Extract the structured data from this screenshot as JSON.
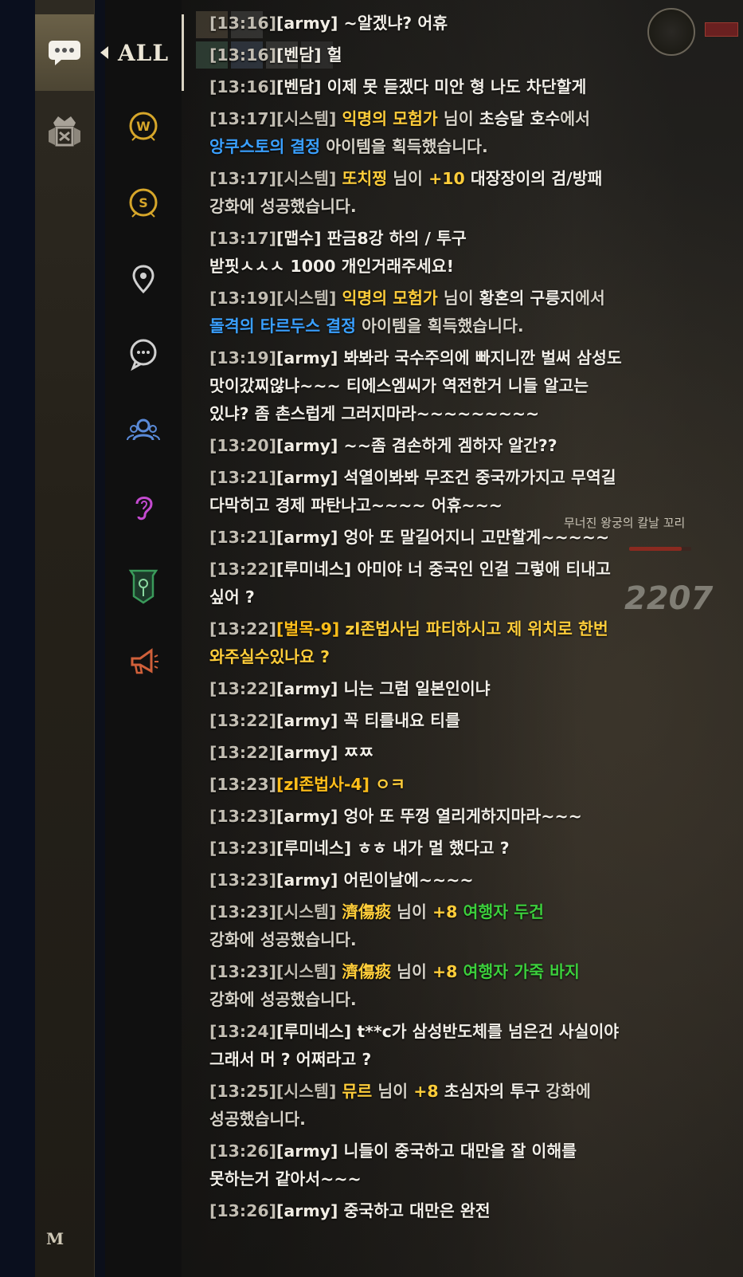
{
  "tabs": {
    "all_label": "ALL"
  },
  "sidebar": {
    "buttons": [
      {
        "icon": "chat-bubble-icon",
        "active": true
      },
      {
        "icon": "guild-crest-icon",
        "active": false
      }
    ],
    "channels": [
      {
        "icon": "world-channel-icon",
        "color": "#d6a62a"
      },
      {
        "icon": "server-channel-icon",
        "color": "#d6a62a"
      },
      {
        "icon": "location-pin-icon",
        "color": "#d0d0d0"
      },
      {
        "icon": "general-chat-icon",
        "color": "#d0d0d0"
      },
      {
        "icon": "party-icon",
        "color": "#5a8ad8"
      },
      {
        "icon": "whisper-ear-icon",
        "color": "#c44ad0"
      },
      {
        "icon": "guild-banner-icon",
        "color": "#3a9a5a"
      },
      {
        "icon": "megaphone-icon",
        "color": "#d0603a"
      }
    ],
    "bottom_label": "M"
  },
  "map": {
    "location_label": "무너진 왕궁의 칼날 꼬리",
    "damage_number": "2207",
    "monster_hp": 0.85
  },
  "colors": {
    "timestamp": "#c2bdb2",
    "yellow_name": "#ffbe1a",
    "item_blue": "#3aa0ff",
    "item_green": "#3ccf3c"
  },
  "messages": [
    {
      "parts": [
        {
          "t": "[13:16]",
          "c": "ts"
        },
        {
          "t": "[army]",
          "c": "snd"
        },
        {
          "t": " ~알겠냐? 어휴"
        }
      ]
    },
    {
      "parts": [
        {
          "t": "[13:16]",
          "c": "ts"
        },
        {
          "t": "[벤담]",
          "c": "snd"
        },
        {
          "t": " 헐"
        }
      ]
    },
    {
      "parts": [
        {
          "t": "[13:16]",
          "c": "ts"
        },
        {
          "t": "[벤담]",
          "c": "snd"
        },
        {
          "t": " 이제 못 듣겠다 미안 형 나도 차단할게"
        }
      ]
    },
    {
      "parts": [
        {
          "t": "[13:17]",
          "c": "ts"
        },
        {
          "t": "[시스템]",
          "c": "snd-sys"
        },
        {
          "t": " "
        },
        {
          "t": "익명의 모험가",
          "c": "hl-yel"
        },
        {
          "t": " 님이 ",
          "c": "dim"
        },
        {
          "t": "초승달 호수"
        },
        {
          "t": "에서",
          "c": "dim"
        },
        {
          "t": "\n"
        },
        {
          "t": "앙쿠스토의 결정",
          "c": "hl-blue"
        },
        {
          "t": " 아이템을 획득했습니다.",
          "c": "dim"
        }
      ]
    },
    {
      "parts": [
        {
          "t": "[13:17]",
          "c": "ts"
        },
        {
          "t": "[시스템]",
          "c": "snd-sys"
        },
        {
          "t": " "
        },
        {
          "t": "또치찡",
          "c": "hl-yel"
        },
        {
          "t": " 님이 ",
          "c": "dim"
        },
        {
          "t": "+10",
          "c": "hl-yel"
        },
        {
          "t": " 대장장이의 검/방패"
        },
        {
          "t": "\n"
        },
        {
          "t": "강화에 성공했습니다.",
          "c": "dim"
        }
      ]
    },
    {
      "parts": [
        {
          "t": "[13:17]",
          "c": "ts"
        },
        {
          "t": "[맵수]",
          "c": "snd"
        },
        {
          "t": " 판금8강 하의 / 투구"
        },
        {
          "t": "\n"
        },
        {
          "t": "받핏ㅅㅅㅅ 1000 개인거래주세요!"
        }
      ]
    },
    {
      "parts": [
        {
          "t": "[13:19]",
          "c": "ts"
        },
        {
          "t": "[시스템]",
          "c": "snd-sys"
        },
        {
          "t": " "
        },
        {
          "t": "익명의 모험가",
          "c": "hl-yel"
        },
        {
          "t": " 님이 ",
          "c": "dim"
        },
        {
          "t": "황혼의 구릉지"
        },
        {
          "t": "에서",
          "c": "dim"
        },
        {
          "t": "\n"
        },
        {
          "t": "돌격의 타르두스 결정",
          "c": "hl-blue"
        },
        {
          "t": " 아이템을 획득했습니다.",
          "c": "dim"
        }
      ]
    },
    {
      "parts": [
        {
          "t": "[13:19]",
          "c": "ts"
        },
        {
          "t": "[army]",
          "c": "snd"
        },
        {
          "t": " 봐봐라 국수주의에 빠지니깐 벌써 삼성도"
        },
        {
          "t": "\n"
        },
        {
          "t": "맛이갔찌않냐~~~ 티에스엠씨가 역전한거 니들 알고는"
        },
        {
          "t": "\n"
        },
        {
          "t": "있냐? 좀 촌스럽게 그러지마라~~~~~~~~~"
        }
      ]
    },
    {
      "parts": [
        {
          "t": "[13:20]",
          "c": "ts"
        },
        {
          "t": "[army]",
          "c": "snd"
        },
        {
          "t": " ~~좀 겸손하게 겜하자 알간??"
        }
      ]
    },
    {
      "parts": [
        {
          "t": "[13:21]",
          "c": "ts"
        },
        {
          "t": "[army]",
          "c": "snd"
        },
        {
          "t": " 석열이봐봐 무조건 중국까가지고 무역길"
        },
        {
          "t": "\n"
        },
        {
          "t": "다막히고 경제 파탄나고~~~~ 어휴~~~"
        }
      ]
    },
    {
      "parts": [
        {
          "t": "[13:21]",
          "c": "ts"
        },
        {
          "t": "[army]",
          "c": "snd"
        },
        {
          "t": " 엉아 또 말길어지니 고만할게~~~~~"
        }
      ]
    },
    {
      "parts": [
        {
          "t": "[13:22]",
          "c": "ts"
        },
        {
          "t": "[루미네스]",
          "c": "snd"
        },
        {
          "t": " 아미야 너 중국인 인걸 그렇애 티내고"
        },
        {
          "t": "\n"
        },
        {
          "t": "싶어 ?"
        }
      ]
    },
    {
      "parts": [
        {
          "t": "[13:22]",
          "c": "ts"
        },
        {
          "t": "[벌목-9]",
          "c": "snd-yel"
        },
        {
          "t": " zl존법사님 파티하시고 제 위치로 한번",
          "c": "hl-yel"
        },
        {
          "t": "\n"
        },
        {
          "t": "와주실수있나요 ?",
          "c": "hl-yel"
        }
      ]
    },
    {
      "parts": [
        {
          "t": "[13:22]",
          "c": "ts"
        },
        {
          "t": "[army]",
          "c": "snd"
        },
        {
          "t": " 니는 그럼 일본인이냐"
        }
      ]
    },
    {
      "parts": [
        {
          "t": "[13:22]",
          "c": "ts"
        },
        {
          "t": "[army]",
          "c": "snd"
        },
        {
          "t": " 꼭 티를내요 티를"
        }
      ]
    },
    {
      "parts": [
        {
          "t": "[13:22]",
          "c": "ts"
        },
        {
          "t": "[army]",
          "c": "snd"
        },
        {
          "t": " ㅉㅉ"
        }
      ]
    },
    {
      "parts": [
        {
          "t": "[13:23]",
          "c": "ts"
        },
        {
          "t": "[zl존법사-4]",
          "c": "snd-yel"
        },
        {
          "t": " ㅇㅋ",
          "c": "hl-yel"
        }
      ]
    },
    {
      "parts": [
        {
          "t": "[13:23]",
          "c": "ts"
        },
        {
          "t": "[army]",
          "c": "snd"
        },
        {
          "t": " 엉아 또 뚜껑 열리게하지마라~~~"
        }
      ]
    },
    {
      "parts": [
        {
          "t": "[13:23]",
          "c": "ts"
        },
        {
          "t": "[루미네스]",
          "c": "snd"
        },
        {
          "t": " ㅎㅎ 내가 멀 했다고 ?"
        }
      ]
    },
    {
      "parts": [
        {
          "t": "[13:23]",
          "c": "ts"
        },
        {
          "t": "[army]",
          "c": "snd"
        },
        {
          "t": " 어린이날에~~~~"
        }
      ]
    },
    {
      "parts": [
        {
          "t": "[13:23]",
          "c": "ts"
        },
        {
          "t": "[시스템]",
          "c": "snd-sys"
        },
        {
          "t": " "
        },
        {
          "t": "濟傷痰",
          "c": "hl-yel"
        },
        {
          "t": " 님이 ",
          "c": "dim"
        },
        {
          "t": "+8",
          "c": "hl-yel"
        },
        {
          "t": " 여행자 두건",
          "c": "hl-green"
        },
        {
          "t": "\n"
        },
        {
          "t": "강화에 성공했습니다.",
          "c": "dim"
        }
      ]
    },
    {
      "parts": [
        {
          "t": "[13:23]",
          "c": "ts"
        },
        {
          "t": "[시스템]",
          "c": "snd-sys"
        },
        {
          "t": " "
        },
        {
          "t": "濟傷痰",
          "c": "hl-yel"
        },
        {
          "t": " 님이 ",
          "c": "dim"
        },
        {
          "t": "+8",
          "c": "hl-yel"
        },
        {
          "t": " 여행자 가죽 바지",
          "c": "hl-green"
        },
        {
          "t": "\n"
        },
        {
          "t": "강화에 성공했습니다.",
          "c": "dim"
        }
      ]
    },
    {
      "parts": [
        {
          "t": "[13:24]",
          "c": "ts"
        },
        {
          "t": "[루미네스]",
          "c": "snd"
        },
        {
          "t": " t**c가 삼성반도체를 넘은건 사실이야"
        },
        {
          "t": "\n"
        },
        {
          "t": "그래서 머 ? 어쩌라고 ?"
        }
      ]
    },
    {
      "parts": [
        {
          "t": "[13:25]",
          "c": "ts"
        },
        {
          "t": "[시스템]",
          "c": "snd-sys"
        },
        {
          "t": " "
        },
        {
          "t": "뮤르",
          "c": "hl-yel"
        },
        {
          "t": " 님이 ",
          "c": "dim"
        },
        {
          "t": "+8",
          "c": "hl-yel"
        },
        {
          "t": " 초심자의 투구"
        },
        {
          "t": " 강화에",
          "c": "dim"
        },
        {
          "t": "\n"
        },
        {
          "t": "성공했습니다.",
          "c": "dim"
        }
      ]
    },
    {
      "parts": [
        {
          "t": "[13:26]",
          "c": "ts"
        },
        {
          "t": "[army]",
          "c": "snd"
        },
        {
          "t": " 니들이 중국하고 대만을 잘 이해를"
        },
        {
          "t": "\n"
        },
        {
          "t": "못하는거 같아서~~~"
        }
      ]
    },
    {
      "parts": [
        {
          "t": "[13:26]",
          "c": "ts"
        },
        {
          "t": "[army]",
          "c": "snd"
        },
        {
          "t": " 중국하고 대만은 완전"
        }
      ]
    }
  ]
}
